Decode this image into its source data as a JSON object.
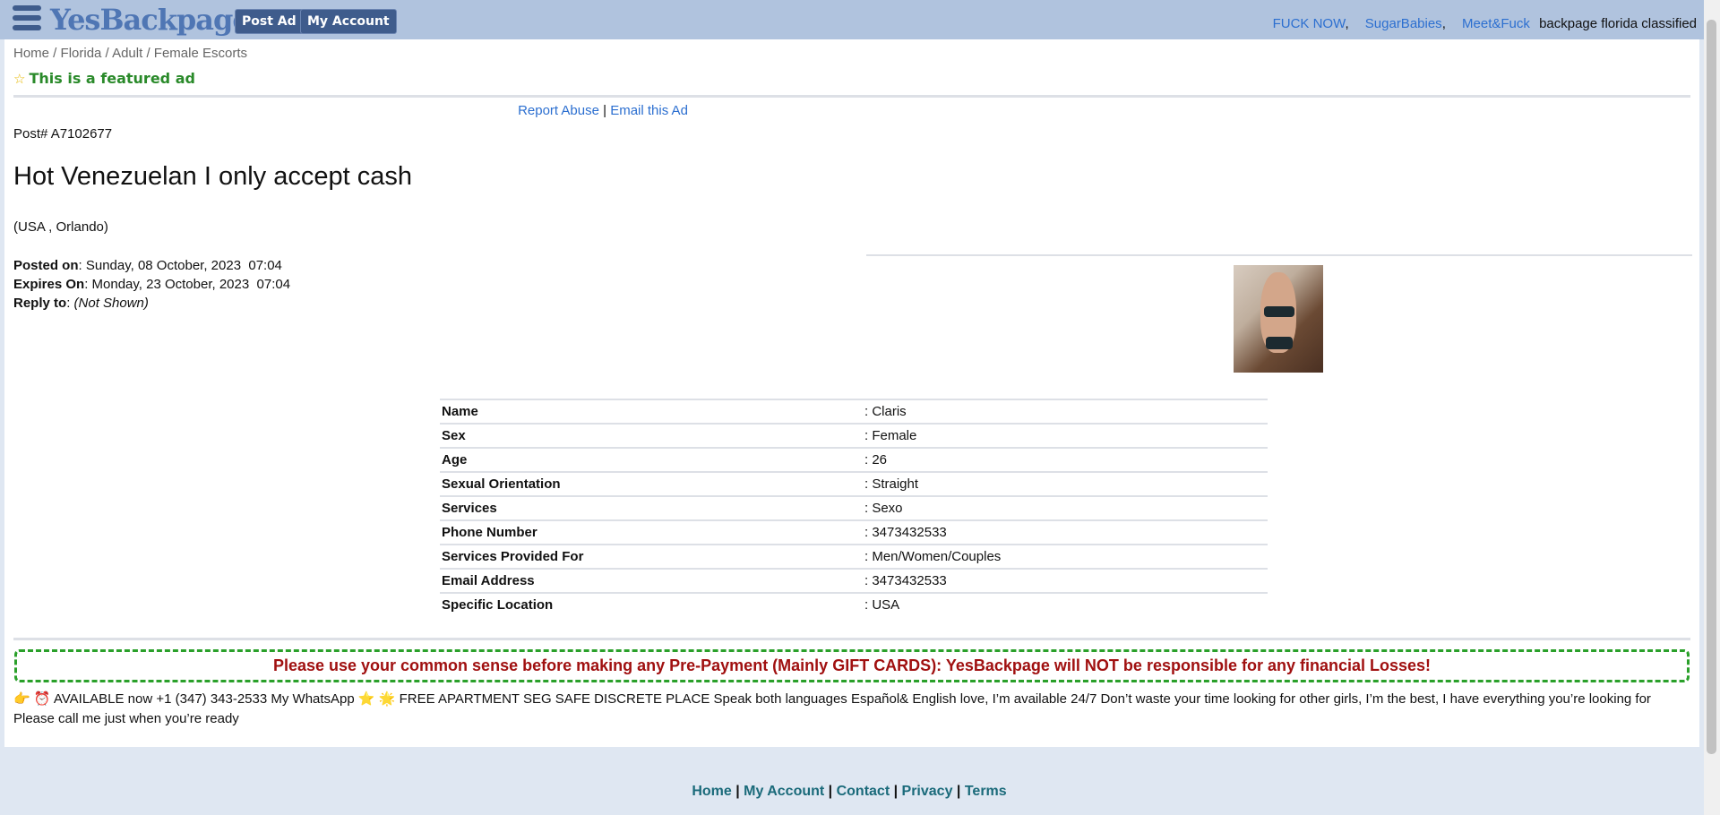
{
  "header": {
    "logo": "YesBackpage",
    "post_ad": "Post Ad",
    "my_account": "My Account",
    "links": [
      "FUCK NOW",
      "SugarBabies",
      "Meet&Fuck"
    ],
    "tagline": "backpage florida classified"
  },
  "breadcrumb": [
    "Home",
    "Florida",
    "Adult",
    "Female Escorts"
  ],
  "featured": "This is a featured ad",
  "actions": {
    "report": "Report Abuse",
    "email": "Email this Ad"
  },
  "post": {
    "number": "Post# A7102677",
    "title": "Hot Venezuelan I only accept cash",
    "location": "(USA , Orlando)",
    "posted_label": "Posted on",
    "posted_value": ": Sunday, 08 October, 2023  07:04",
    "expires_label": "Expires On",
    "expires_value": ": Monday, 23 October, 2023  07:04",
    "reply_label": "Reply to",
    "reply_value": "(Not Shown)"
  },
  "details": [
    {
      "key": "Name",
      "value": ": Claris"
    },
    {
      "key": "Sex",
      "value": ": Female"
    },
    {
      "key": "Age",
      "value": ": 26"
    },
    {
      "key": "Sexual Orientation",
      "value": ": Straight"
    },
    {
      "key": "Services",
      "value": ": Sexo"
    },
    {
      "key": "Phone Number",
      "value": ": 3473432533"
    },
    {
      "key": "Services Provided For",
      "value": ": Men/Women/Couples"
    },
    {
      "key": "Email Address",
      "value": ": 3473432533"
    },
    {
      "key": "Specific Location",
      "value": ": USA"
    }
  ],
  "warning": "Please use your common sense before making any Pre-Payment (Mainly GIFT CARDS): YesBackpage will NOT be responsible for any financial Losses!",
  "description": "👉 ⏰ AVAILABLE now +1 (347) 343-2533 My WhatsApp ⭐ 🌟 FREE APARTMENT SEG SAFE DISCRETE PLACE Speak both languages Español& English love, I’m available 24/7 Don’t waste your time looking for other girls, I’m the best, I have everything you’re looking for Please call me just when you’re ready",
  "footer": [
    "Home",
    "My Account",
    "Contact",
    "Privacy",
    "Terms"
  ]
}
